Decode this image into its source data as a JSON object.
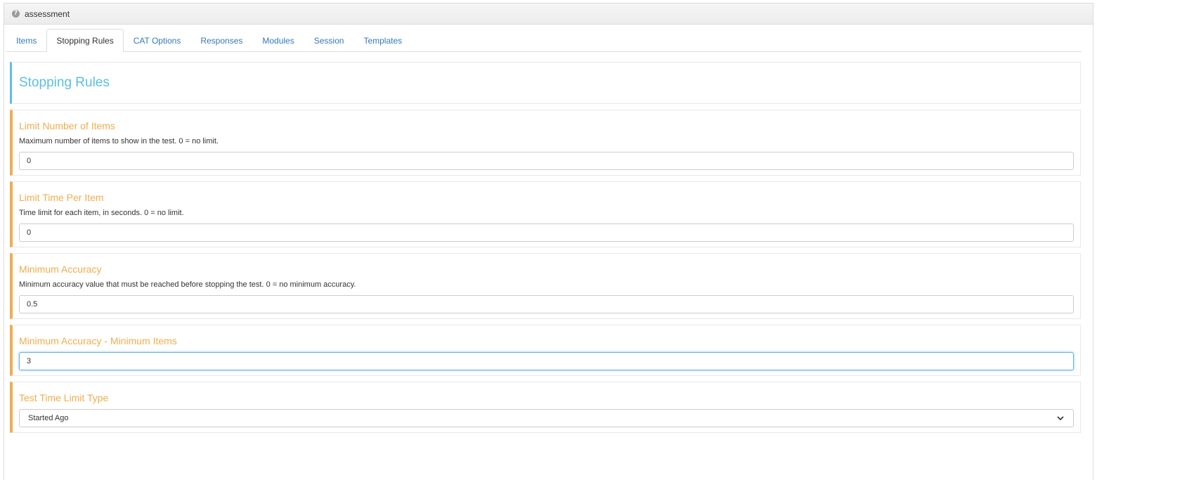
{
  "panel": {
    "title": "assessment"
  },
  "tabs": [
    {
      "label": "Items"
    },
    {
      "label": "Stopping Rules",
      "active": true
    },
    {
      "label": "CAT Options"
    },
    {
      "label": "Responses"
    },
    {
      "label": "Modules"
    },
    {
      "label": "Session"
    },
    {
      "label": "Templates"
    }
  ],
  "section": {
    "title": "Stopping Rules"
  },
  "fields": {
    "limit_items": {
      "label": "Limit Number of Items",
      "description": "Maximum number of items to show in the test. 0 = no limit.",
      "value": "0"
    },
    "limit_time": {
      "label": "Limit Time Per Item",
      "description": "Time limit for each item, in seconds. 0 = no limit.",
      "value": "0"
    },
    "min_accuracy": {
      "label": "Minimum Accuracy",
      "description": "Minimum accuracy value that must be reached before stopping the test. 0 = no minimum accuracy.",
      "value": "0.5"
    },
    "min_accuracy_items": {
      "label": "Minimum Accuracy - Minimum Items",
      "value": "3"
    },
    "time_limit_type": {
      "label": "Test Time Limit Type",
      "selected": "Started Ago"
    }
  },
  "colors": {
    "tab_link": "#337ab7",
    "section_accent": "#5bc0de",
    "field_accent": "#f0ad4e",
    "focus_border": "#66afe9"
  }
}
